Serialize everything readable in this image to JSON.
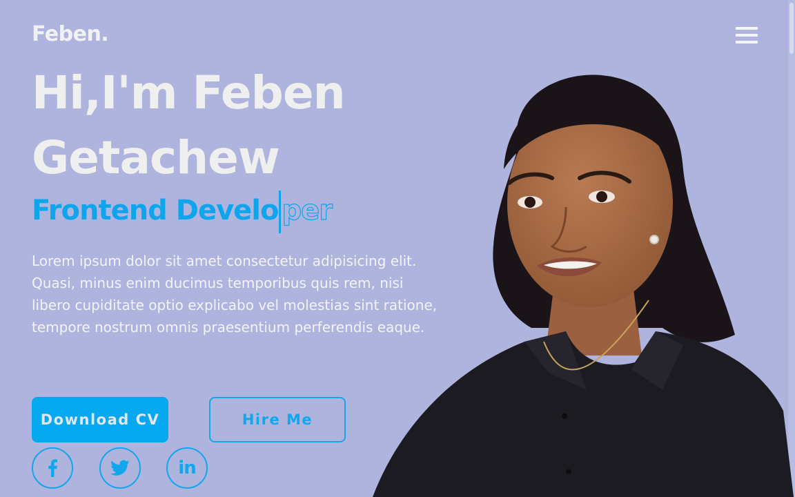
{
  "header": {
    "logo": "Feben.",
    "menu_icon": "hamburger-menu-icon"
  },
  "hero": {
    "title_line1": "Hi,I'm Feben",
    "title_line2": "Getachew",
    "role_typed": "Frontend Develo",
    "role_remaining": "per",
    "description": "Lorem ipsum dolor sit amet consectetur adipisicing elit. Quasi, minus enim ducimus temporibus quis rem, nisi libero cupiditate optio explicabo vel molestias sint ratione, tempore nostrum omnis praesentium perferendis eaque."
  },
  "buttons": {
    "download_label": "Download CV",
    "hire_label": "Hire Me"
  },
  "social": {
    "facebook_icon": "facebook-icon",
    "twitter_icon": "twitter-icon",
    "linkedin_icon": "linkedin-icon",
    "linkedin_text": "in"
  },
  "colors": {
    "background": "#aeb4de",
    "accent": "#0ea5ec",
    "heading": "#efefef",
    "shirt": "#1c1b22",
    "skin": "#a86c48"
  }
}
